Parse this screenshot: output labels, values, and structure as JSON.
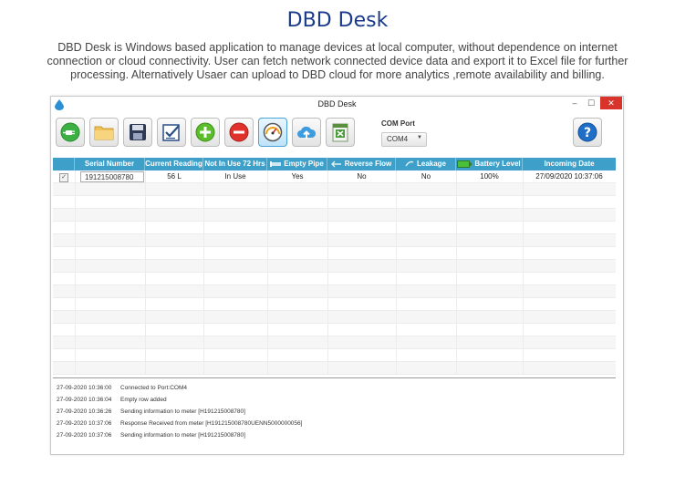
{
  "page": {
    "title": "DBD Desk",
    "description": "DBD Desk is Windows based application to manage devices at local computer, without dependence on internet connection or cloud connectivity. User can  fetch network connected device data and export it to Excel file for further processing. Alternatively Usaer can upload to DBD cloud for more analytics ,remote availability and billing."
  },
  "window": {
    "title": "DBD Desk",
    "minimize": "–",
    "maximize": "☐",
    "close": "✕"
  },
  "toolbar": {
    "buttons": [
      "plug-icon",
      "folder-icon",
      "save-icon",
      "checklist-icon",
      "add-icon",
      "remove-icon",
      "gauge-icon",
      "cloud-upload-icon",
      "excel-export-icon",
      "help-icon"
    ],
    "com_port_label": "COM Port",
    "com_port_value": "COM4"
  },
  "table": {
    "headers": [
      "",
      "Serial Number",
      "Current Reading",
      "Not In Use 72 Hrs",
      "Empty Pipe",
      "Reverse Flow",
      "Leakage",
      "Battery Level",
      "Incoming Date"
    ],
    "rows": [
      {
        "checked": true,
        "serial": "191215008780",
        "current_reading": "56 L",
        "not_in_use": "In Use",
        "empty_pipe": "Yes",
        "reverse_flow": "No",
        "leakage": "No",
        "battery": "100%",
        "incoming_date": "27/09/2020 10:37:06"
      }
    ]
  },
  "log": [
    {
      "time": "27-09-2020 10:36:00",
      "message": "Connected to Port:COM4"
    },
    {
      "time": "27-09-2020 10:36:04",
      "message": "Empty row added"
    },
    {
      "time": "27-09-2020 10:36:26",
      "message": "Sending information to meter [H191215008780]"
    },
    {
      "time": "27-09-2020 10:37:06",
      "message": "Response Received from meter [H191215008780UENN5000000056]"
    },
    {
      "time": "27-09-2020 10:37:06",
      "message": "Sending information to meter [H191215008780]"
    }
  ],
  "colors": {
    "header_bg": "#3e9fc8",
    "title_blue": "#1a3a8c",
    "close_red": "#d9342b"
  }
}
